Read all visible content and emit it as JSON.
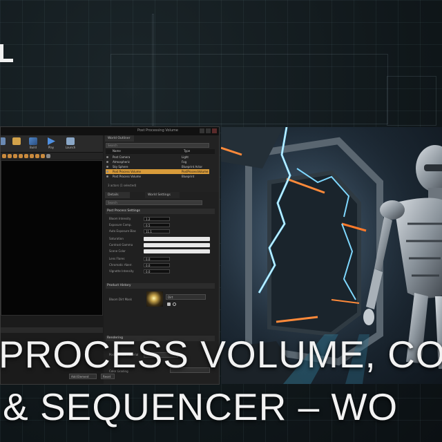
{
  "thumbnail": {
    "title_line1": "PROCESS VOLUME, CO",
    "title_line2": "& SEQUENCER – WO"
  },
  "editor": {
    "window_title": "Post Processing Volume",
    "toolbar": [
      {
        "label": "",
        "icon": "save-icon"
      },
      {
        "label": "",
        "icon": "content-icon"
      },
      {
        "label": "Build",
        "icon": "build-icon"
      },
      {
        "label": "Play",
        "icon": "play-icon"
      },
      {
        "label": "Launch",
        "icon": "launch-icon"
      }
    ],
    "outliner": {
      "tab": "World Outliner",
      "search_placeholder": "Search",
      "columns": {
        "name": "Name",
        "type": "Type"
      },
      "rows": [
        {
          "name": "Post Camera",
          "type": "Light"
        },
        {
          "name": "Atmospheric",
          "type": "Fog"
        },
        {
          "name": "Sky Sphere",
          "type": "Blueprint Actor"
        },
        {
          "name": "Post Process Volume",
          "type": "PostProcessVolume",
          "selected": true
        },
        {
          "name": "Post Process Volume",
          "type": "Blueprint"
        }
      ],
      "footer": "3 actors (1 selected)"
    },
    "details": {
      "tabs": [
        "Details",
        "World Settings"
      ],
      "search_placeholder": "Search",
      "section_main": "Post Process Settings",
      "properties": [
        {
          "label": "Bloom Intensity",
          "value": "1.2"
        },
        {
          "label": "Exposure Comp.",
          "value": "0.5"
        },
        {
          "label": "Auto Exposure Bias",
          "value": "11.1"
        },
        {
          "label": "Saturation",
          "value": ""
        },
        {
          "label": "Contrast Gamma",
          "value": ""
        },
        {
          "label": "Scene Color",
          "value": ""
        },
        {
          "label": "Lens Flares",
          "value": "0.0"
        },
        {
          "label": "Chromatic Aberr.",
          "value": "0.0"
        },
        {
          "label": "Vignette Intensity",
          "value": "0.0"
        }
      ],
      "section_history": "Product History",
      "history_label": "Bloom Dirt Mask",
      "history_dropdown": "Dirt",
      "section_bottom": "Rendering",
      "bottom_rows": [
        {
          "label": "Post Process Material"
        },
        {
          "label": "Color Grading"
        }
      ],
      "buttons": [
        "Add Element",
        "Reset"
      ]
    }
  },
  "colors": {
    "selection": "#d89b3a",
    "title_text": "#f2f2f2",
    "lightning": "#7fd8ff",
    "neon_orange": "#ff8a3a"
  }
}
